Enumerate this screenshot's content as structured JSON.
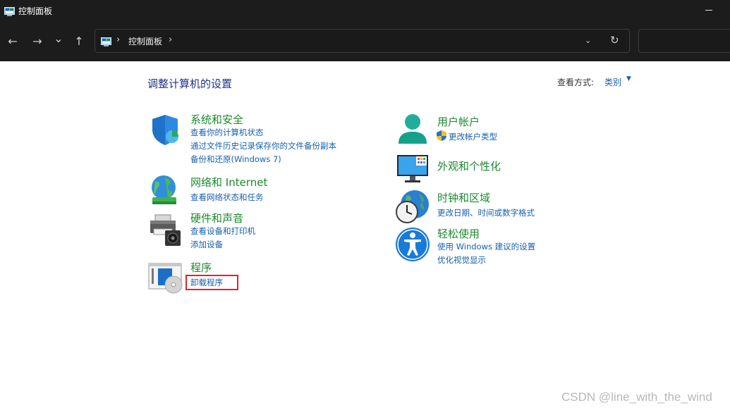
{
  "window": {
    "title": "控制面板"
  },
  "nav": {
    "back_glyph": "←",
    "forward_glyph": "→",
    "recent_glyph": "⌄",
    "up_glyph": "↑",
    "crumb_sep": "›",
    "breadcrumb": "控制面板",
    "dropdown_glyph": "⌄",
    "refresh_glyph": "↻"
  },
  "header": {
    "heading": "调整计算机的设置",
    "view_by_label": "查看方式:",
    "view_by_value": "类别",
    "view_by_caret": "▼"
  },
  "left_categories": [
    {
      "title": "系统和安全",
      "icon": "security-shield-icon",
      "links": [
        "查看你的计算机状态",
        "通过文件历史记录保存你的文件备份副本",
        "备份和还原(Windows 7)"
      ]
    },
    {
      "title": "网络和 Internet",
      "icon": "network-globe-icon",
      "links": [
        "查看网络状态和任务"
      ]
    },
    {
      "title": "硬件和声音",
      "icon": "printer-speaker-icon",
      "links": [
        "查看设备和打印机",
        "添加设备"
      ]
    },
    {
      "title": "程序",
      "icon": "programs-disc-icon",
      "links": [
        "卸载程序"
      ]
    }
  ],
  "right_categories": [
    {
      "title": "用户帐户",
      "icon": "user-accounts-icon",
      "links": [
        "更改帐户类型"
      ]
    },
    {
      "title": "外观和个性化",
      "icon": "monitor-personalization-icon",
      "links": []
    },
    {
      "title": "时钟和区域",
      "icon": "clock-globe-icon",
      "links": [
        "更改日期、时间或数字格式"
      ]
    },
    {
      "title": "轻松使用",
      "icon": "accessibility-icon",
      "links": [
        "使用 Windows 建议的设置",
        "优化视觉显示"
      ]
    }
  ],
  "colors": {
    "heading": "#1e3287",
    "category_title": "#1b8a2e",
    "link": "#1660b0",
    "highlight": "#e0242c"
  },
  "watermark": "CSDN @line_with_the_wind"
}
